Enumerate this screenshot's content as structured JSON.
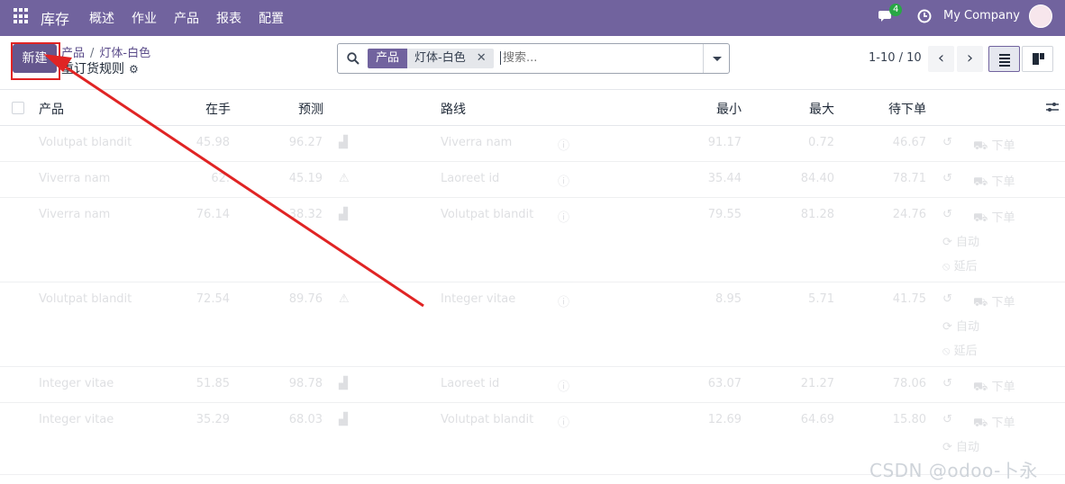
{
  "navbar": {
    "app_name": "库存",
    "menu": [
      "概述",
      "作业",
      "产品",
      "报表",
      "配置"
    ],
    "chat_count": "4",
    "company": "My Company",
    "bg_color": "#71639e"
  },
  "control": {
    "new_label": "新建",
    "breadcrumb": [
      "产品",
      "灯体-白色"
    ],
    "title": "重订货规则",
    "search": {
      "facet_label": "产品",
      "facet_value": "灯体-白色",
      "placeholder": "搜索..."
    },
    "pager": "1-10 / 10"
  },
  "table": {
    "columns": [
      "产品",
      "在手",
      "预测",
      "路线",
      "最小",
      "最大",
      "待下单"
    ],
    "rows": [
      {
        "product": "Volutpat blandit",
        "onhand": "45.98",
        "forecast": "96.27",
        "route": "Viverra nam",
        "min": "91.17",
        "max": "0.72",
        "order": "46.67",
        "actions": [
          "下单"
        ]
      },
      {
        "product": "Viverra nam",
        "onhand": "62.",
        "forecast": "45.19",
        "route": "Laoreet id",
        "min": "35.44",
        "max": "84.40",
        "order": "78.71",
        "actions": [
          "下单"
        ]
      },
      {
        "product": "Viverra nam",
        "onhand": "76.14",
        "forecast": "38.32",
        "route": "Volutpat blandit",
        "min": "79.55",
        "max": "81.28",
        "order": "24.76",
        "actions": [
          "下单",
          "自动",
          "延后"
        ]
      },
      {
        "product": "Volutpat blandit",
        "onhand": "72.54",
        "forecast": "89.76",
        "route": "Integer vitae",
        "min": "8.95",
        "max": "5.71",
        "order": "41.75",
        "actions": [
          "下单",
          "自动",
          "延后"
        ]
      },
      {
        "product": "Integer vitae",
        "onhand": "51.85",
        "forecast": "98.78",
        "route": "Laoreet id",
        "min": "63.07",
        "max": "21.27",
        "order": "78.06",
        "actions": [
          "下单"
        ]
      },
      {
        "product": "Integer vitae",
        "onhand": "35.29",
        "forecast": "68.03",
        "route": "Volutpat blandit",
        "min": "12.69",
        "max": "64.69",
        "order": "15.80",
        "actions": [
          "下单",
          "自动"
        ]
      }
    ]
  },
  "watermark": "CSDN @odoo-卜永"
}
